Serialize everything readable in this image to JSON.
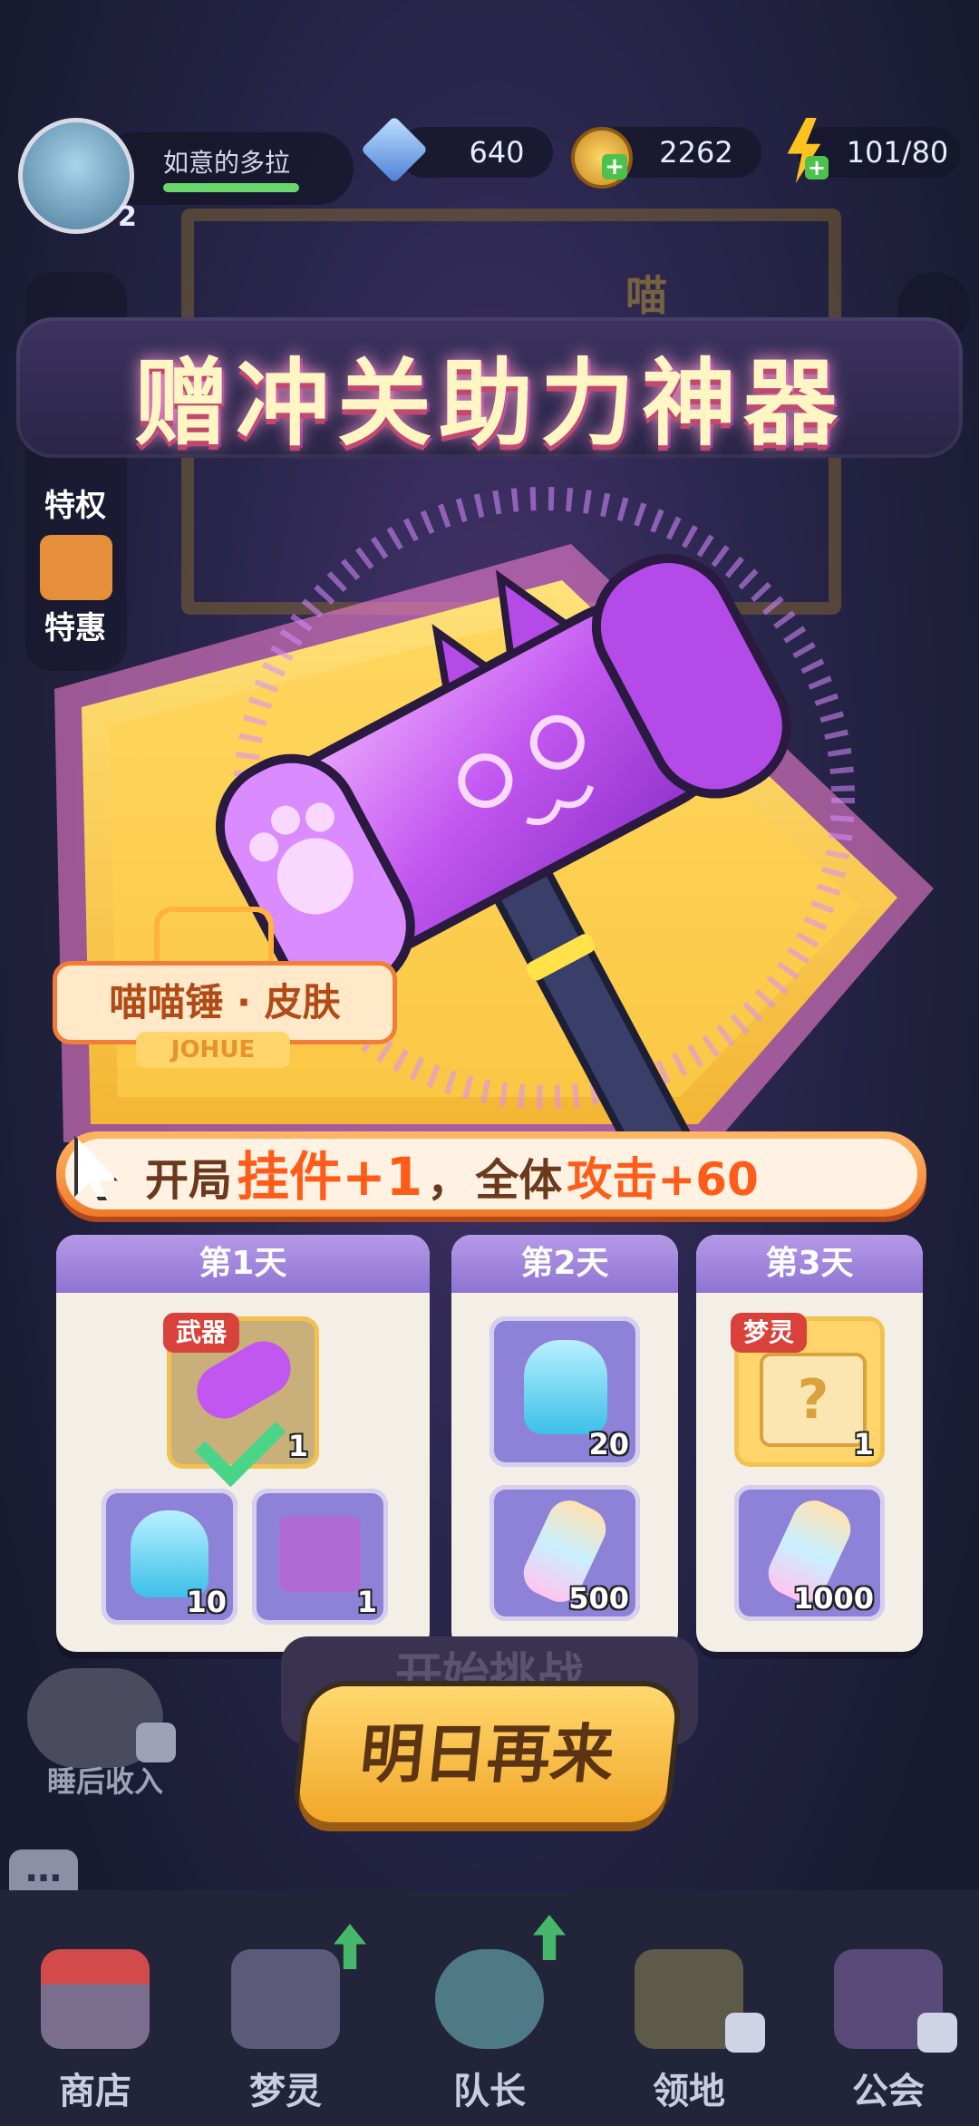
{
  "player": {
    "name": "如意的多拉",
    "level": "2"
  },
  "currencies": {
    "gems": "640",
    "coins": "2262",
    "energy": "101/80"
  },
  "side_menu": {
    "privilege": "特权",
    "special": "特惠",
    "sleep_income": "睡后收入"
  },
  "bg_text": {
    "meow": "喵",
    "start_challenge": "开始挑战"
  },
  "popup": {
    "title": "赠冲关助力神器",
    "skin_name": "喵喵锤 · 皮肤",
    "skin_sub": "JOHUE",
    "bonus": {
      "prefix": "开局",
      "highlight": "挂件+1",
      "comma": "，",
      "middle": "全体",
      "highlight2": "攻击+60"
    },
    "days": [
      {
        "label": "第1天",
        "items": [
          {
            "name": "hammer-skin",
            "tag": "武器",
            "qty": "1",
            "claimed": true
          },
          {
            "name": "spirit-crystal",
            "qty": "10"
          },
          {
            "name": "mystery-box",
            "qty": "1"
          }
        ]
      },
      {
        "label": "第2天",
        "items": [
          {
            "name": "spirit-crystal",
            "qty": "20"
          },
          {
            "name": "rainbow-bottle",
            "qty": "500"
          }
        ]
      },
      {
        "label": "第3天",
        "items": [
          {
            "name": "spirit-chest",
            "tag": "梦灵",
            "qty": "1"
          },
          {
            "name": "rainbow-bottle",
            "qty": "1000"
          }
        ]
      }
    ],
    "button": "明日再来"
  },
  "nav": {
    "shop": "商店",
    "spirit": "梦灵",
    "captain": "队长",
    "territory": "领地",
    "guild": "公会"
  },
  "colors": {
    "accent": "#f2a72a",
    "title": "#fff6c4",
    "card_header": "#9c82dc"
  }
}
